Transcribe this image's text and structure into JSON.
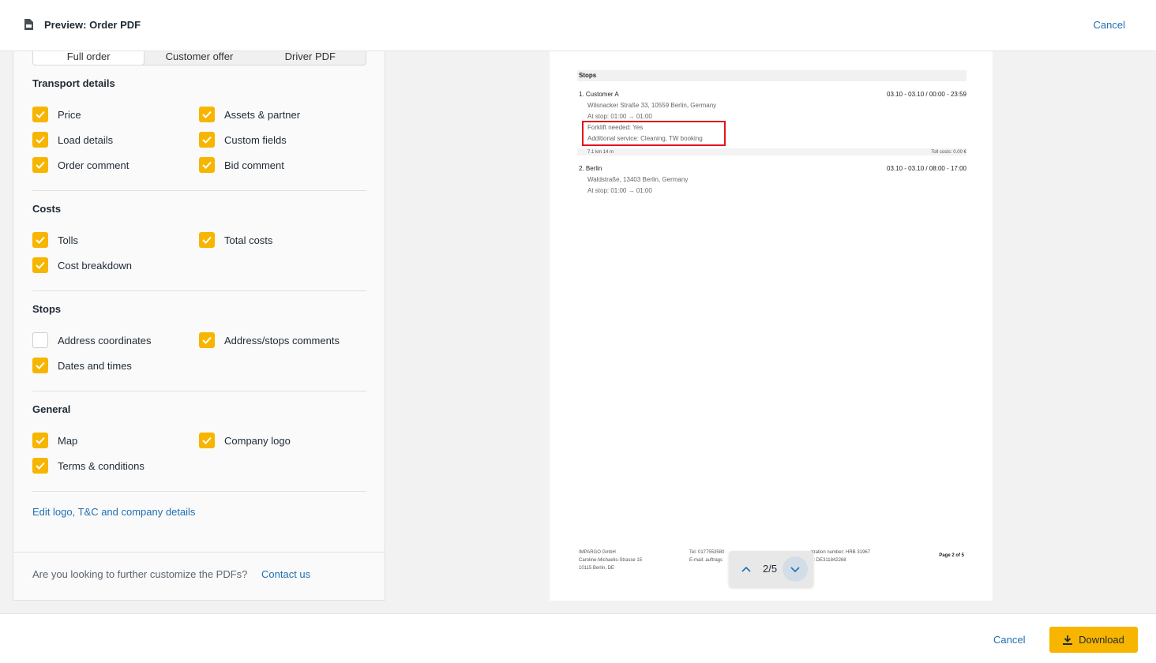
{
  "header": {
    "title": "Preview: Order PDF",
    "cancel_label": "Cancel"
  },
  "tabs": [
    {
      "label": "Full order",
      "active": true
    },
    {
      "label": "Customer offer",
      "active": false
    },
    {
      "label": "Driver PDF",
      "active": false
    }
  ],
  "sections": {
    "transport": {
      "title": "Transport details",
      "items": [
        {
          "label": "Price",
          "checked": true
        },
        {
          "label": "Assets & partner",
          "checked": true
        },
        {
          "label": "Load details",
          "checked": true
        },
        {
          "label": "Custom fields",
          "checked": true
        },
        {
          "label": "Order comment",
          "checked": true
        },
        {
          "label": "Bid comment",
          "checked": true
        }
      ]
    },
    "costs": {
      "title": "Costs",
      "items": [
        {
          "label": "Tolls",
          "checked": true
        },
        {
          "label": "Total costs",
          "checked": true
        },
        {
          "label": "Cost breakdown",
          "checked": true
        }
      ]
    },
    "stops": {
      "title": "Stops",
      "items": [
        {
          "label": "Address coordinates",
          "checked": false
        },
        {
          "label": "Address/stops comments",
          "checked": true
        },
        {
          "label": "Dates and times",
          "checked": true
        }
      ]
    },
    "general": {
      "title": "General",
      "items": [
        {
          "label": "Map",
          "checked": true
        },
        {
          "label": "Company logo",
          "checked": true
        },
        {
          "label": "Terms & conditions",
          "checked": true
        }
      ]
    }
  },
  "edit_link": "Edit logo, T&C and company details",
  "footer_question": "Are you looking to further customize the PDFs?",
  "contact_link": "Contact us",
  "preview": {
    "stops_heading": "Stops",
    "stop1": {
      "name": "1.  Customer A",
      "time": "03.10 - 03.10 / 00:00 - 23:59",
      "address": "Wilsnacker Straße 33, 10559 Berlin, Germany",
      "at_stop": "At stop: 01:00 → 01:00",
      "forklift": "Forklift needed: Yes",
      "additional": "Additional service: Cleaning, TW booking",
      "distance": "7.1 km  14 m",
      "toll": "Toll costs: 0.00 €"
    },
    "stop2": {
      "name": "2.  Berlin",
      "time": "03.10 - 03.10 / 08:00 - 17:00",
      "address": "Waldstraße, 13403 Berlin, Germany",
      "at_stop": "At stop: 01:00 → 01:00"
    },
    "footer": {
      "company": "IMPARGO GmbH",
      "street": "Caroline-Michaelis-Strasse 15",
      "city": "10115 Berlin, DE",
      "tel": "Tel: 0177553580",
      "email": "E-mail: auftrags",
      "registration": "stration number: HRB 31967",
      "vat": "D: DE311842268",
      "page": "Page 2 of 5"
    }
  },
  "pager": {
    "label": "2/5"
  },
  "bottom": {
    "cancel_label": "Cancel",
    "download_label": "Download"
  },
  "colors": {
    "accent": "#f7b500",
    "link": "#1f6fb5",
    "highlight": "#e0141e"
  }
}
